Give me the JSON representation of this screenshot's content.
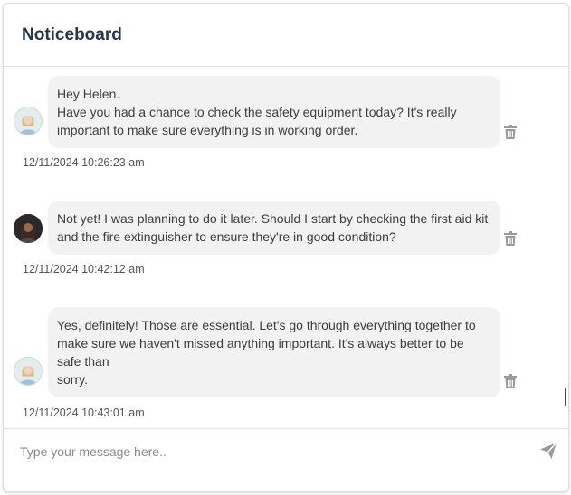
{
  "header": {
    "title": "Noticeboard"
  },
  "messages": [
    {
      "avatar": "woman-light-avatar",
      "text": "Hey Helen.\nHave you had a chance to check the safety equipment today? It's really important to make sure everything is in working order.",
      "timestamp": "12/11/2024 10:26:23 am"
    },
    {
      "avatar": "woman-dark-avatar",
      "text": "Not yet! I was planning to do it later. Should I start by checking the first aid kit and the fire extinguisher to ensure they're in good condition?",
      "timestamp": "12/11/2024 10:42:12 am"
    },
    {
      "avatar": "woman-light-avatar",
      "text": "Yes, definitely! Those are essential. Let's go through everything together to make sure we haven't missed anything important. It's always better to be safe than\nsorry.",
      "timestamp": "12/11/2024 10:43:01 am"
    }
  ],
  "composer": {
    "placeholder": "Type your message here.."
  },
  "icons": {
    "delete": "trash-icon",
    "send": "send-icon"
  },
  "colors": {
    "title": "#243647",
    "bubble": "#f2f2f2",
    "icon": "#9a9a9a"
  }
}
